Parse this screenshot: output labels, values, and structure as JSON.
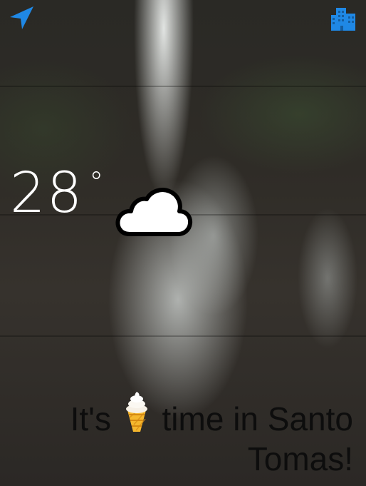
{
  "weather": {
    "temperature": "28",
    "degree_symbol": "°",
    "condition_icon": "cloud-icon"
  },
  "toolbar": {
    "left_icon": "navigation-arrow-icon",
    "right_icon": "city-buildings-icon",
    "accent_color": "#1f88e5"
  },
  "message": {
    "prefix": "It's",
    "emoji_icon": "soft-serve-ice-cream-icon",
    "suffix": "time in Santo Tomas!"
  }
}
